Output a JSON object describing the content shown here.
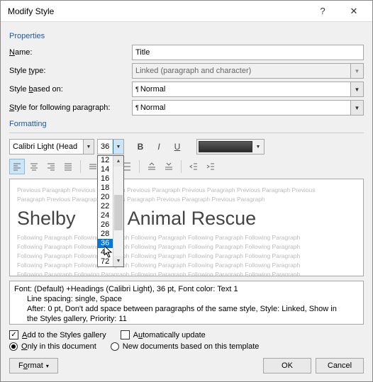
{
  "titlebar": {
    "title": "Modify Style",
    "help": "?",
    "close": "✕"
  },
  "sections": {
    "properties": "Properties",
    "formatting": "Formatting"
  },
  "labels": {
    "name_pre": "",
    "name_u": "N",
    "name_post": "ame:",
    "styletype_pre": "Style ",
    "styletype_u": "t",
    "styletype_post": "ype:",
    "basedon_pre": "Style ",
    "basedon_u": "b",
    "basedon_post": "ased on:",
    "following_pre": "",
    "following_u": "S",
    "following_post": "tyle for following paragraph:"
  },
  "fields": {
    "name": "Title",
    "styletype": "Linked (paragraph and character)",
    "basedon": "Normal",
    "following": "Normal",
    "font": "Calibri Light (Head",
    "size": "36"
  },
  "size_options": [
    "12",
    "14",
    "16",
    "18",
    "20",
    "22",
    "24",
    "26",
    "28",
    "36",
    "48",
    "72"
  ],
  "size_selected": "36",
  "fmt_btn": {
    "bold": "B",
    "italic": "I",
    "underline": "U"
  },
  "preview": {
    "prev1": "Previous Paragraph Previous Paragraph Previous Paragraph Previous Paragraph Previous Paragraph Previous",
    "prev2": "Paragraph Previous Paragraph Previous Paragraph Previous Paragraph Previous Paragraph",
    "sample_a": "Shelby",
    "sample_b": "ld Animal Rescue",
    "foll": "Following Paragraph Following Paragraph Following Paragraph Following Paragraph Following Paragraph"
  },
  "desc": {
    "l1": "Font: (Default) +Headings (Calibri Light), 36 pt, Font color: Text 1",
    "l2": "Line spacing:  single, Space",
    "l3": "After:  0 pt, Don't add space between paragraphs of the same style, Style: Linked, Show in",
    "l4": "the Styles gallery, Priority: 11"
  },
  "checks": {
    "add_u": "A",
    "add_post": "dd to the Styles gallery",
    "auto_pre": "A",
    "auto_u": "u",
    "auto_post": "tomatically update",
    "only_pre": "",
    "only_u": "O",
    "only_post": "nly in this document",
    "new_pre": "New documents based on this template"
  },
  "buttons": {
    "format_pre": "F",
    "format_u": "o",
    "format_post": "rmat",
    "ok": "OK",
    "cancel": "Cancel"
  }
}
